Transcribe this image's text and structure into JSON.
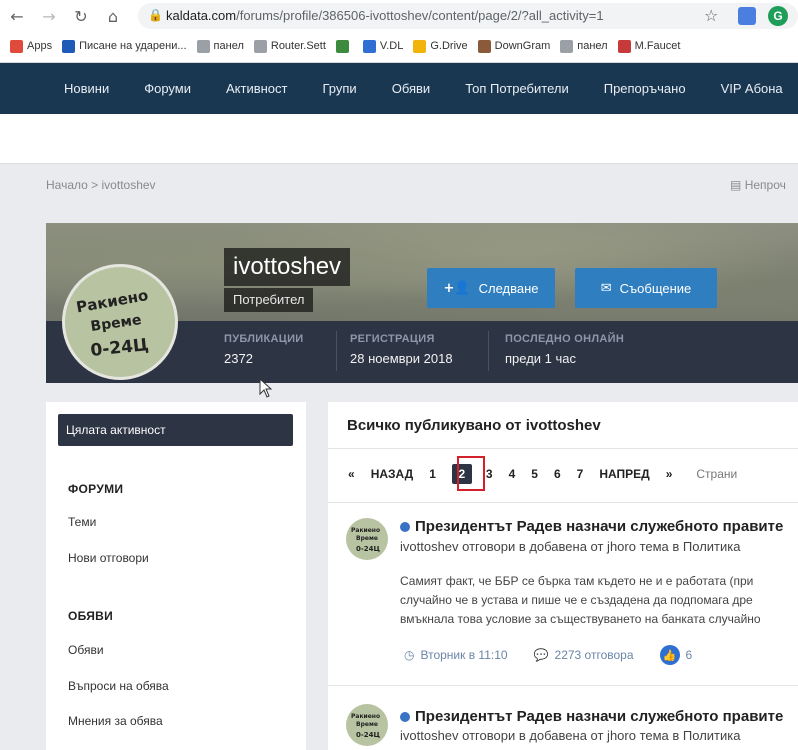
{
  "browser": {
    "url_host": "kaldata.com",
    "url_path": "/forums/profile/386506-ivottoshev/content/page/2/?all_activity=1",
    "ext2_letter": "G",
    "bookmarks": [
      {
        "label": "Apps",
        "color": "#e04a3a"
      },
      {
        "label": "Писане на ударени...",
        "color": "#1e5bb8"
      },
      {
        "label": "панел",
        "color": "#9aa0a6"
      },
      {
        "label": "Router.Sett",
        "color": "#9aa0a6"
      },
      {
        "label": "",
        "color": "#3b8a3e"
      },
      {
        "label": "V.DL",
        "color": "#2f6fd3"
      },
      {
        "label": "G.Drive",
        "color": "#f2b40a"
      },
      {
        "label": "DownGram",
        "color": "#8a5a3a"
      },
      {
        "label": "панел",
        "color": "#9aa0a6"
      },
      {
        "label": "M.Faucet",
        "color": "#c73a3a"
      }
    ]
  },
  "nav": {
    "items": [
      "Новини",
      "Форуми",
      "Активност",
      "Групи",
      "Обяви",
      "Топ Потребители",
      "Препоръчано",
      "VIP Абона"
    ]
  },
  "breadcrumb": {
    "home": "Начало",
    "sep": ">",
    "current": "ivottoshev"
  },
  "right_link": "Непроч",
  "profile": {
    "username": "ivottoshev",
    "group": "Потребител",
    "follow_label": "Следване",
    "message_label": "Съобщение",
    "stats": [
      {
        "label": "ПУБЛИКАЦИИ",
        "value": "2372"
      },
      {
        "label": "РЕГИСТРАЦИЯ",
        "value": "28 ноември 2018"
      },
      {
        "label": "ПОСЛЕДНО ОНЛАЙН",
        "value": "преди 1 час"
      }
    ]
  },
  "sidebar": {
    "all_activity": "Цялата активност",
    "forums_head": "ФОРУМИ",
    "forums_items": [
      "Теми",
      "Нови отговори"
    ],
    "ads_head": "ОБЯВИ",
    "ads_items": [
      "Обяви",
      "Въпроси на обява",
      "Мнения за обява"
    ]
  },
  "main": {
    "title": "Всичко публикувано от ivottoshev",
    "pager": {
      "first": "«",
      "prev": "НАЗАД",
      "pages": [
        "1",
        "2",
        "3",
        "4",
        "5",
        "6",
        "7"
      ],
      "current": "2",
      "next": "НАПРЕД",
      "last": "»",
      "right": "Страни"
    },
    "posts": [
      {
        "title": "Президентът Радев назначи служебното правите",
        "meta": "ivottoshev отговори в добавена от jhoro тема в Политика",
        "body": [
          "Самият факт, че ББР се бърка там където не и е работата (при",
          "случайно че в устава и пише че е създадена да подпомага дре",
          "вмъкнала това условие за съществуването на банката случайно"
        ],
        "date": "Вторник в 11:10",
        "replies": "2273 отговора",
        "likes": "6"
      },
      {
        "title": "Президентът Радев назначи служебното правите",
        "meta": "ivottoshev отговори в добавена от jhoro тема в Политика"
      }
    ]
  },
  "avatar_text": [
    "Ракиено",
    "Време",
    "0-24Ц"
  ]
}
